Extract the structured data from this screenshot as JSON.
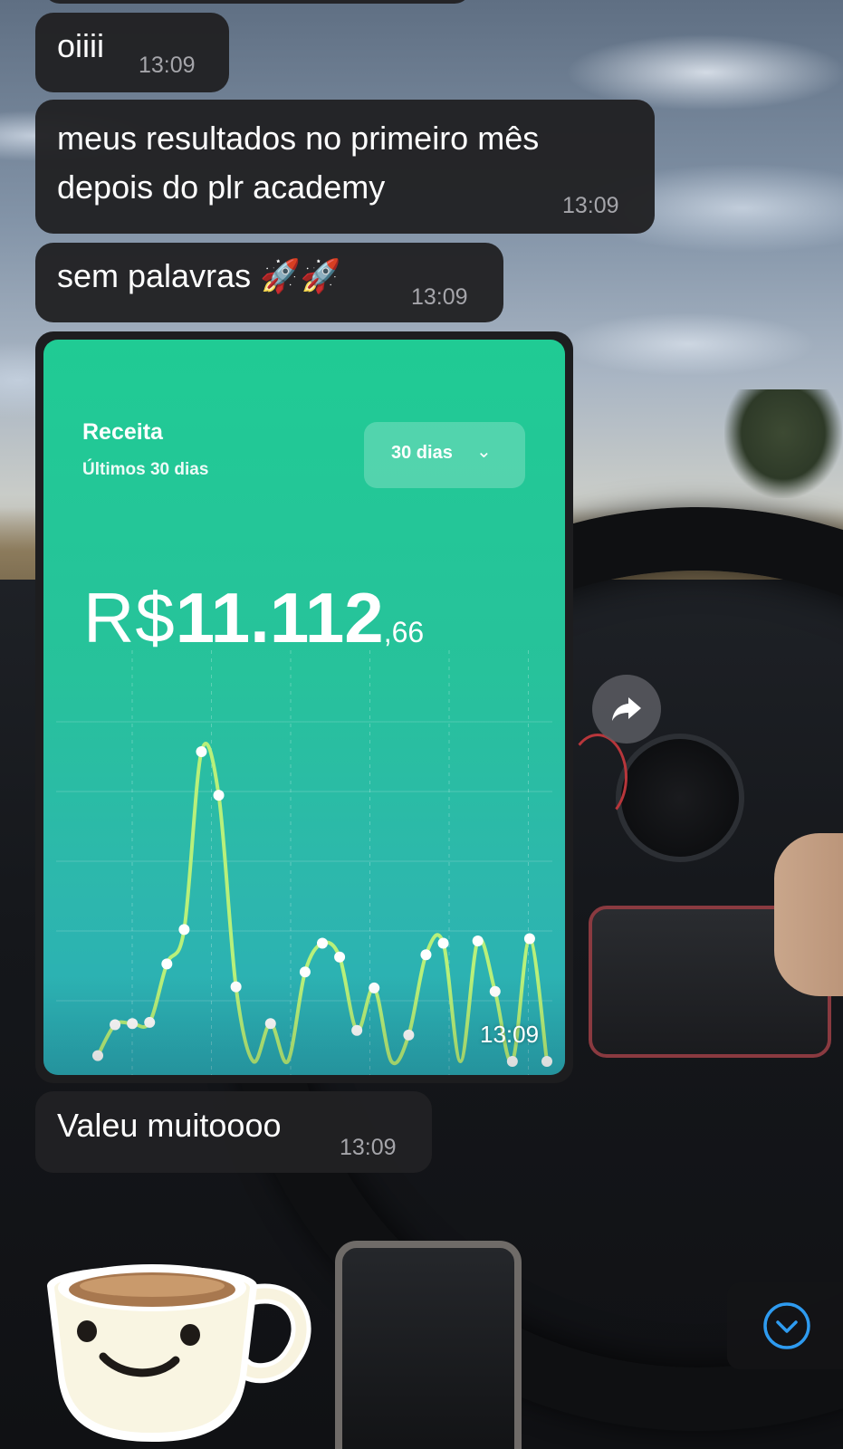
{
  "messages": [
    {
      "text": "oiiii",
      "time": "13:09"
    },
    {
      "text": "meus resultados no primeiro mês\ndepois do plr academy",
      "time": "13:09"
    },
    {
      "text": "sem palavras 🚀🚀",
      "time": "13:09"
    },
    {
      "text": "Valeu muitoooo",
      "time": "13:09"
    }
  ],
  "image_message": {
    "time": "13:09",
    "card": {
      "title": "Receita",
      "subtitle": "Últimos 30 dias",
      "period_label": "30 dias",
      "amount_currency": "R$",
      "amount_integer": "11.112",
      "amount_cents": ",66"
    }
  },
  "chart_data": {
    "type": "line",
    "values": [
      0.5,
      3.2,
      3.3,
      3.4,
      8.5,
      11.5,
      27.0,
      23.2,
      6.5,
      0.0,
      3.3,
      0.0,
      7.8,
      10.3,
      9.1,
      2.7,
      6.4,
      0.0,
      2.3,
      9.3,
      10.3,
      0.0,
      10.5,
      6.1,
      0.0,
      10.7,
      0.0
    ],
    "colors": {
      "line": "#b8f07a",
      "point": "#ffffff",
      "grid": "rgba(255,255,255,0.25)"
    }
  },
  "icons": {
    "forward": "share-forward-icon",
    "scroll_down": "chevron-down-circle-icon",
    "sticker": "coffee-cup-sticker"
  },
  "colors": {
    "bubble": "#212123",
    "time_text": "#a5a5aa",
    "accent_blue": "#2e9bf0"
  }
}
